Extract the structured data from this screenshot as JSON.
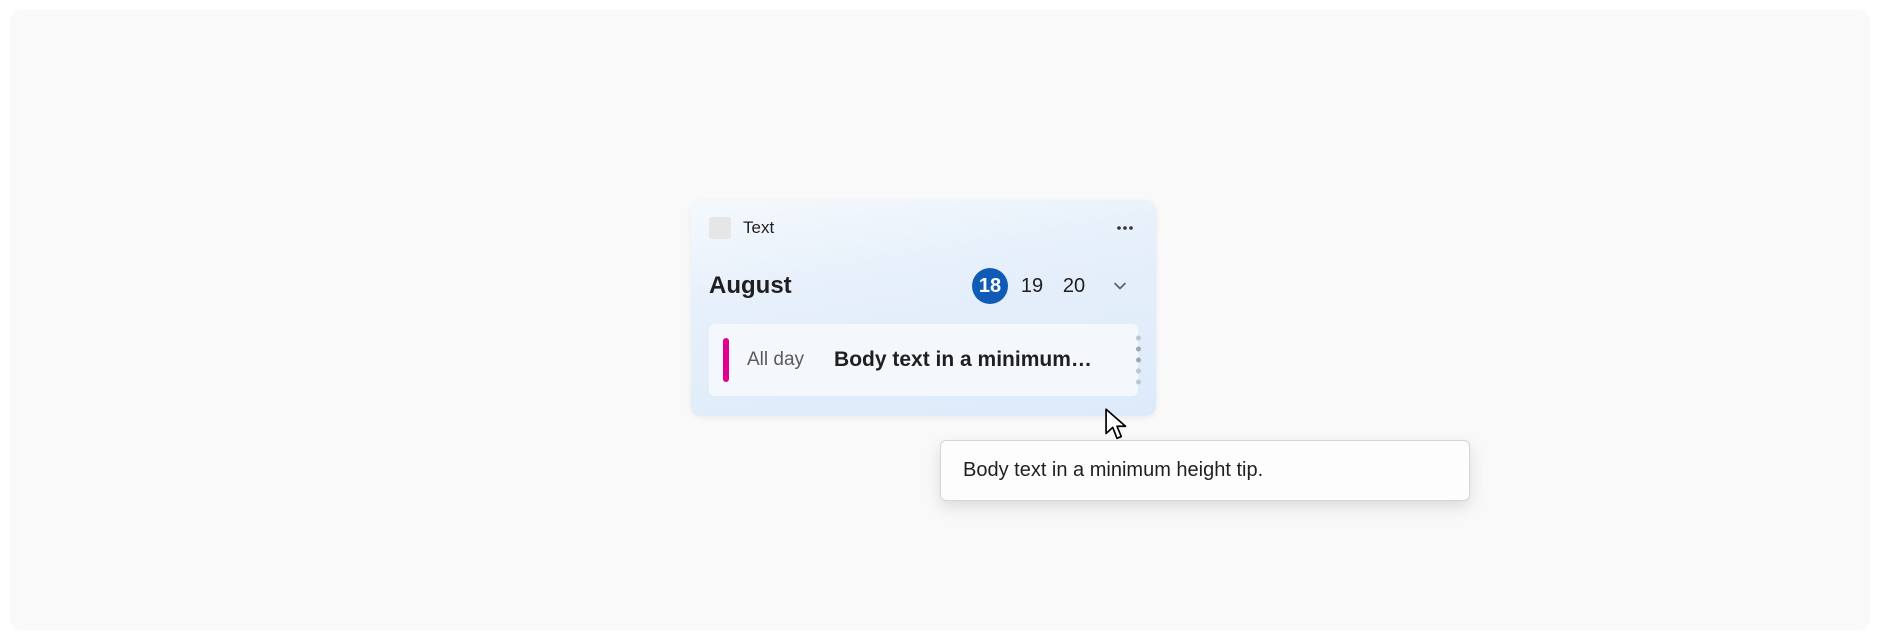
{
  "widget": {
    "header": {
      "title": "Text"
    },
    "month": "August",
    "days": [
      {
        "label": "18",
        "selected": true
      },
      {
        "label": "19",
        "selected": false
      },
      {
        "label": "20",
        "selected": false
      }
    ],
    "event": {
      "time": "All day",
      "body_truncated": "Body text in a minimum…",
      "accent_color": "#e3008c"
    }
  },
  "tooltip": {
    "text": "Body text in a minimum height tip."
  }
}
